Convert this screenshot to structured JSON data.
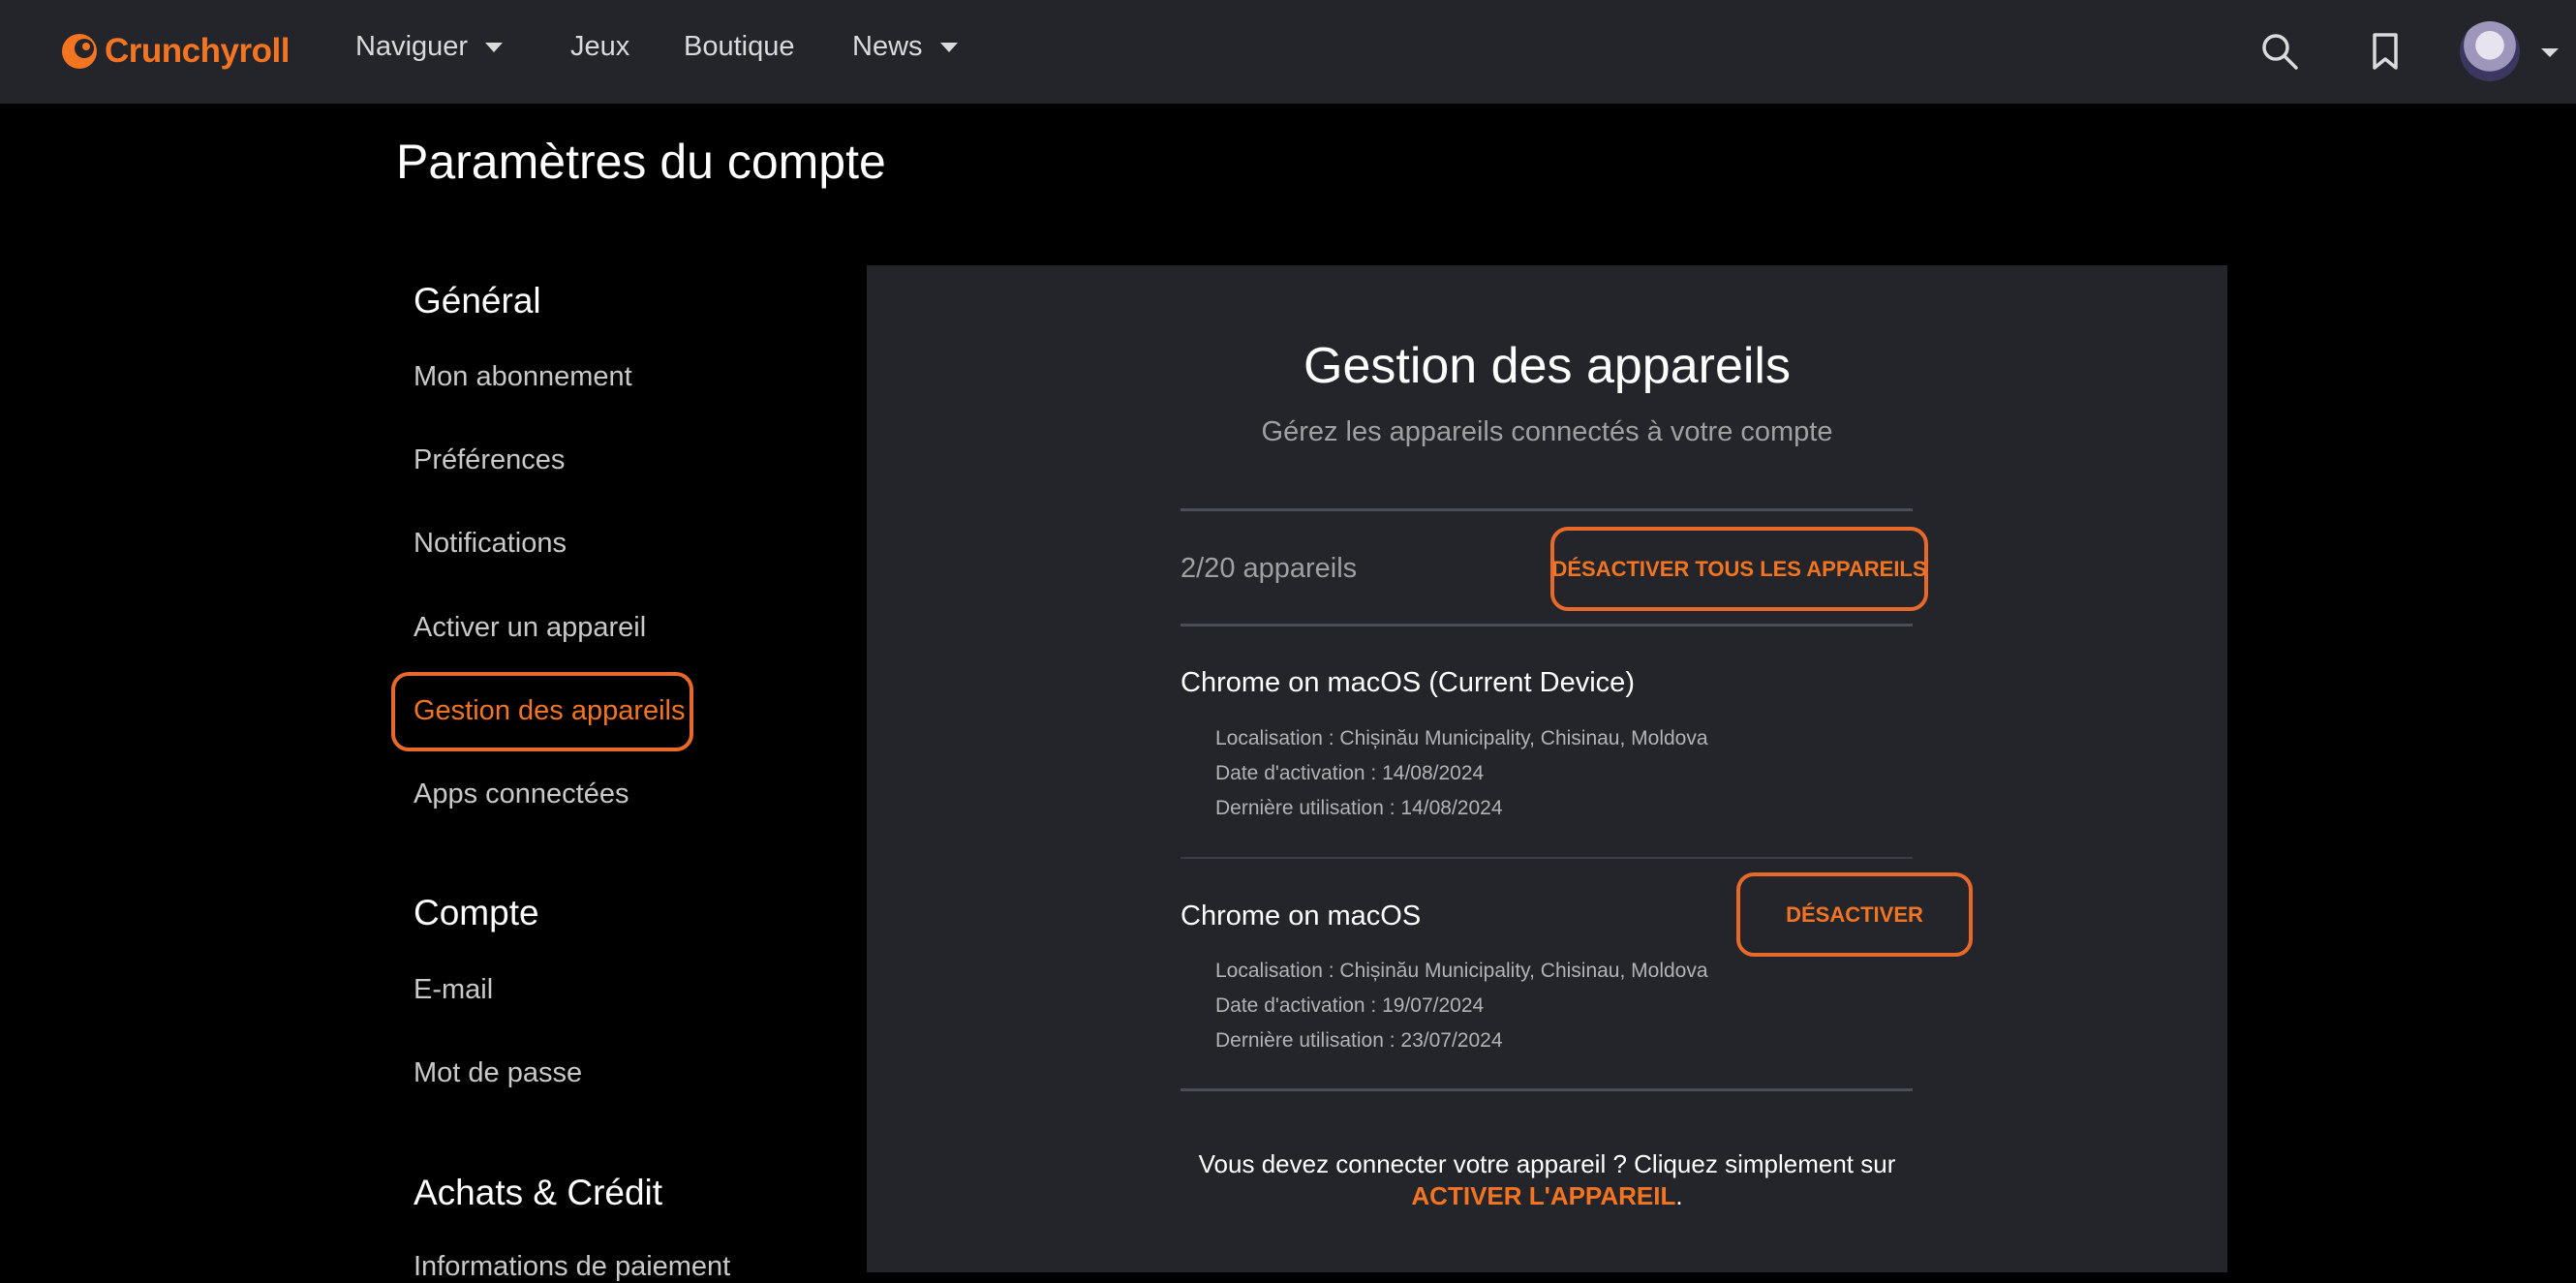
{
  "header": {
    "logo_text": "Crunchyroll",
    "nav": [
      {
        "label": "Naviguer",
        "has_dropdown": true
      },
      {
        "label": "Jeux",
        "has_dropdown": false
      },
      {
        "label": "Boutique",
        "has_dropdown": false
      },
      {
        "label": "News",
        "has_dropdown": true
      }
    ],
    "icons": [
      "search-icon",
      "bookmark-icon",
      "avatar",
      "chevron-down-icon"
    ]
  },
  "page": {
    "title": "Paramètres du compte"
  },
  "sidebar": {
    "sections": [
      {
        "heading": "Général",
        "items": [
          "Mon abonnement",
          "Préférences",
          "Notifications",
          "Activer un appareil",
          "Gestion des appareils",
          "Apps connectées"
        ]
      },
      {
        "heading": "Compte",
        "items": [
          "E-mail",
          "Mot de passe"
        ]
      },
      {
        "heading": "Achats & Crédit",
        "items": [
          "Informations de paiement"
        ]
      }
    ],
    "active_item": "Gestion des appareils"
  },
  "devices_panel": {
    "title": "Gestion des appareils",
    "subtitle": "Gérez les appareils connectés à votre compte",
    "count_text": "2/20 appareils",
    "deactivate_all_label": "DÉSACTIVER TOUS LES APPAREILS",
    "devices": [
      {
        "name": "Chrome on macOS (Current Device)",
        "location": "Localisation : Chișinău Municipality, Chisinau, Moldova",
        "activation_date": "Date d'activation : 14/08/2024",
        "last_used": "Dernière utilisation : 14/08/2024"
      },
      {
        "name": "Chrome on macOS",
        "location": "Localisation : Chișinău Municipality, Chisinau, Moldova",
        "activation_date": "Date d'activation : 19/07/2024",
        "last_used": "Dernière utilisation : 23/07/2024",
        "button_label": "DÉSACTIVER"
      }
    ],
    "footer_text": "Vous devez connecter votre appareil ? Cliquez simplement sur",
    "footer_link": "ACTIVER L'APPAREIL",
    "footer_end": "."
  },
  "colors": {
    "accent": "#f47521",
    "topbar": "#23252b",
    "panel": "#23252b",
    "background": "#000000"
  }
}
